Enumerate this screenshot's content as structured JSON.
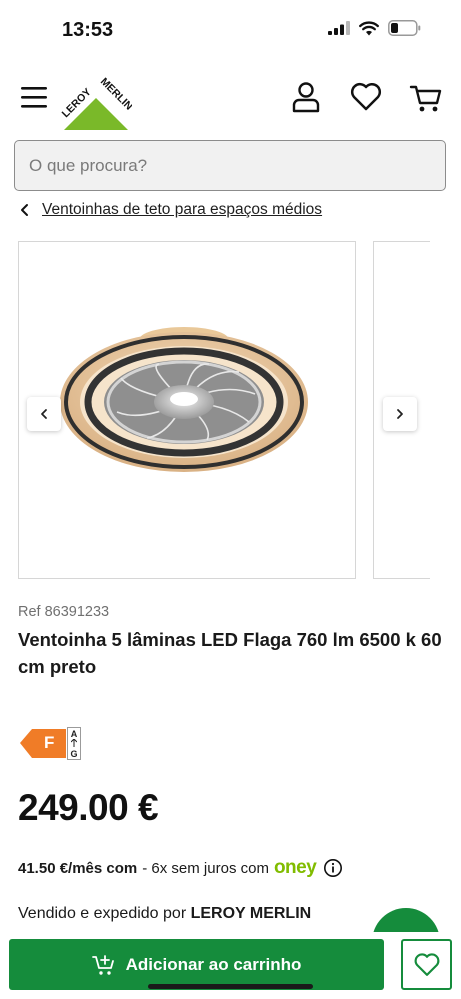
{
  "status_bar": {
    "time": "13:53"
  },
  "header": {
    "logo_text_top": "LEROY",
    "logo_text_bottom": "MERLIN",
    "icons": [
      "menu-icon",
      "user-icon",
      "heart-icon",
      "cart-icon"
    ]
  },
  "search": {
    "placeholder": "O que procura?"
  },
  "breadcrumb": {
    "label": "Ventoinhas de teto para espaços médios"
  },
  "product": {
    "ref": "Ref 86391233",
    "title": "Ventoinha 5 lâminas LED Flaga 760 lm 6500 k 60 cm preto",
    "energy_class": "F",
    "energy_scale_top": "A",
    "energy_scale_bottom": "G",
    "price": "249.00 €",
    "installment_amount": "41.50 €/mês com",
    "installment_text": "- 6x sem juros com",
    "installment_brand": "oney",
    "sold_by_prefix": "Vendido e expedido por",
    "sold_by_name": "LEROY MERLIN"
  },
  "actions": {
    "add_to_cart": "Adicionar ao carrinho"
  },
  "colors": {
    "brand_green": "#158c3c",
    "oney_green": "#81bc00",
    "energy_orange": "#f07c27",
    "logo_green": "#7ab929"
  }
}
